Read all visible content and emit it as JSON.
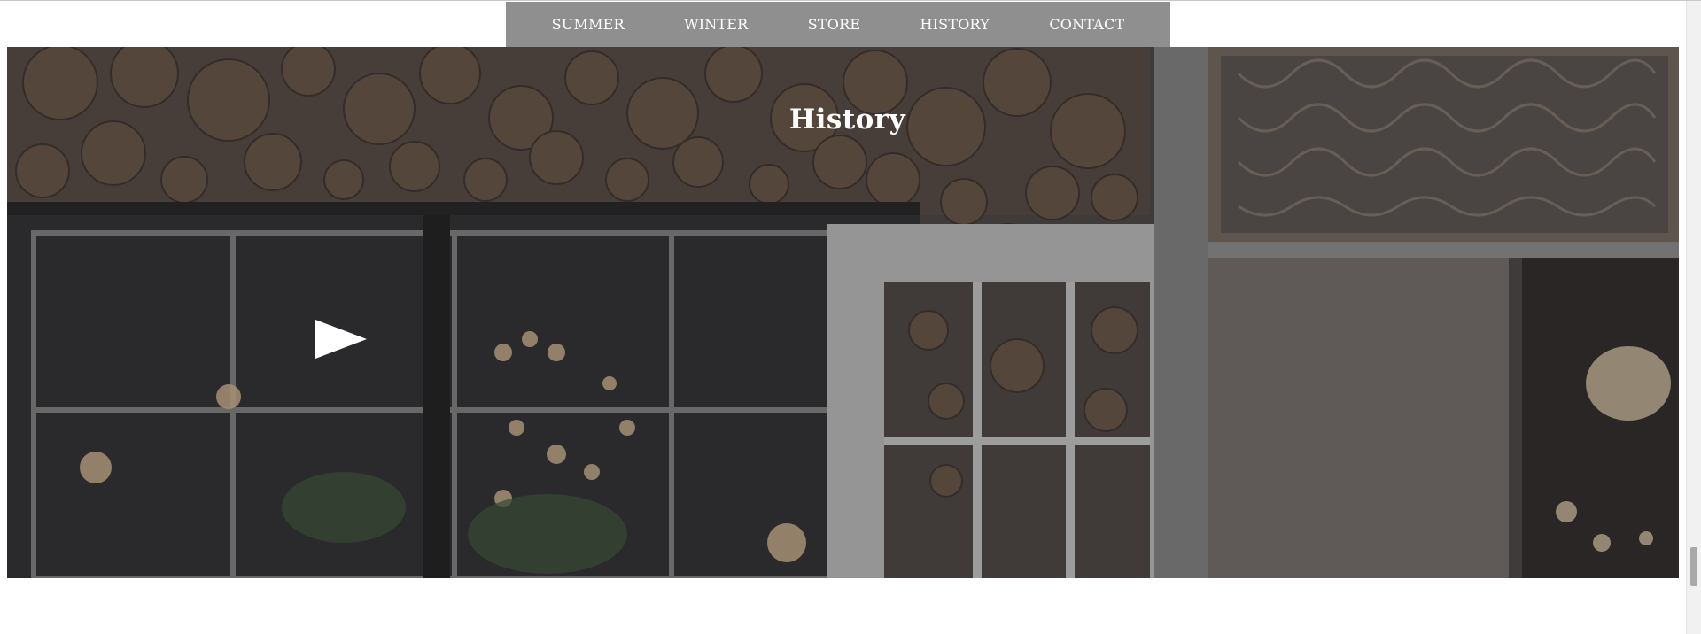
{
  "nav": {
    "items": [
      {
        "label": "SUMMER"
      },
      {
        "label": "WINTER"
      },
      {
        "label": "STORE"
      },
      {
        "label": "HISTORY"
      },
      {
        "label": "CONTACT"
      }
    ]
  },
  "hero": {
    "title": "History",
    "play_icon": "play-icon"
  },
  "colors": {
    "nav_background": "#8f8f8f",
    "nav_text": "#ffffff",
    "hero_title": "#ffffff"
  }
}
